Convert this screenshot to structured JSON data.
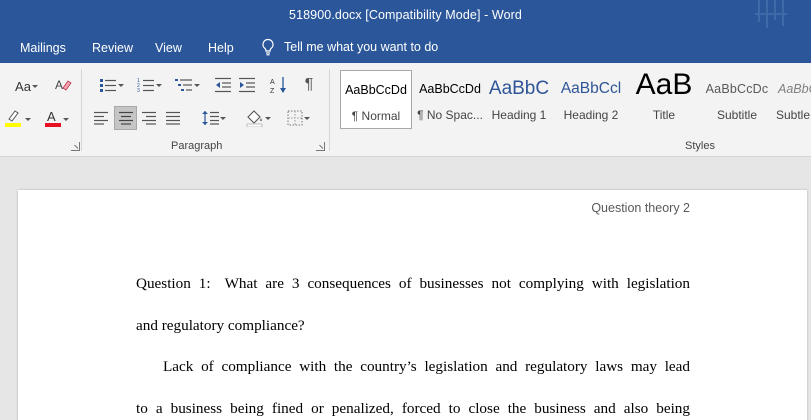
{
  "window": {
    "title": "518900.docx [Compatibility Mode]  -  Word"
  },
  "menu": {
    "tabs": [
      "Mailings",
      "Review",
      "View",
      "Help"
    ],
    "tell_me": "Tell me what you want to do"
  },
  "ribbon": {
    "font_group": {
      "change_case_label": "Aa"
    },
    "paragraph_group": {
      "label": "Paragraph"
    },
    "styles_group": {
      "label": "Styles",
      "items": [
        {
          "preview": "AaBbCcDd",
          "name": "¶ Normal",
          "selected": true
        },
        {
          "preview": "AaBbCcDd",
          "name": "¶ No Spac...",
          "selected": false
        },
        {
          "preview": "AaBbC",
          "name": "Heading 1",
          "selected": false
        },
        {
          "preview": "AaBbCcl",
          "name": "Heading 2",
          "selected": false
        },
        {
          "preview": "AaB",
          "name": "Title",
          "selected": false
        },
        {
          "preview": "AaBbCcDc",
          "name": "Subtitle",
          "selected": false
        },
        {
          "preview": "AaBbCcDd",
          "name": "Subtle",
          "selected": false
        }
      ]
    }
  },
  "colors": {
    "title_bar": "#2b579a",
    "highlight": "#ffff00",
    "font_color": "#e81123"
  },
  "document": {
    "header": "Question theory  2",
    "question_label": "Question 1:",
    "question_line1": "What are 3 consequences of businesses not complying with legislation",
    "question_line2": "and regulatory compliance?",
    "answer_line1": "Lack of compliance with the country’s legislation and regulatory laws may lead",
    "answer_line2": "to a business being fined or penalized, forced to close the business and also being"
  }
}
